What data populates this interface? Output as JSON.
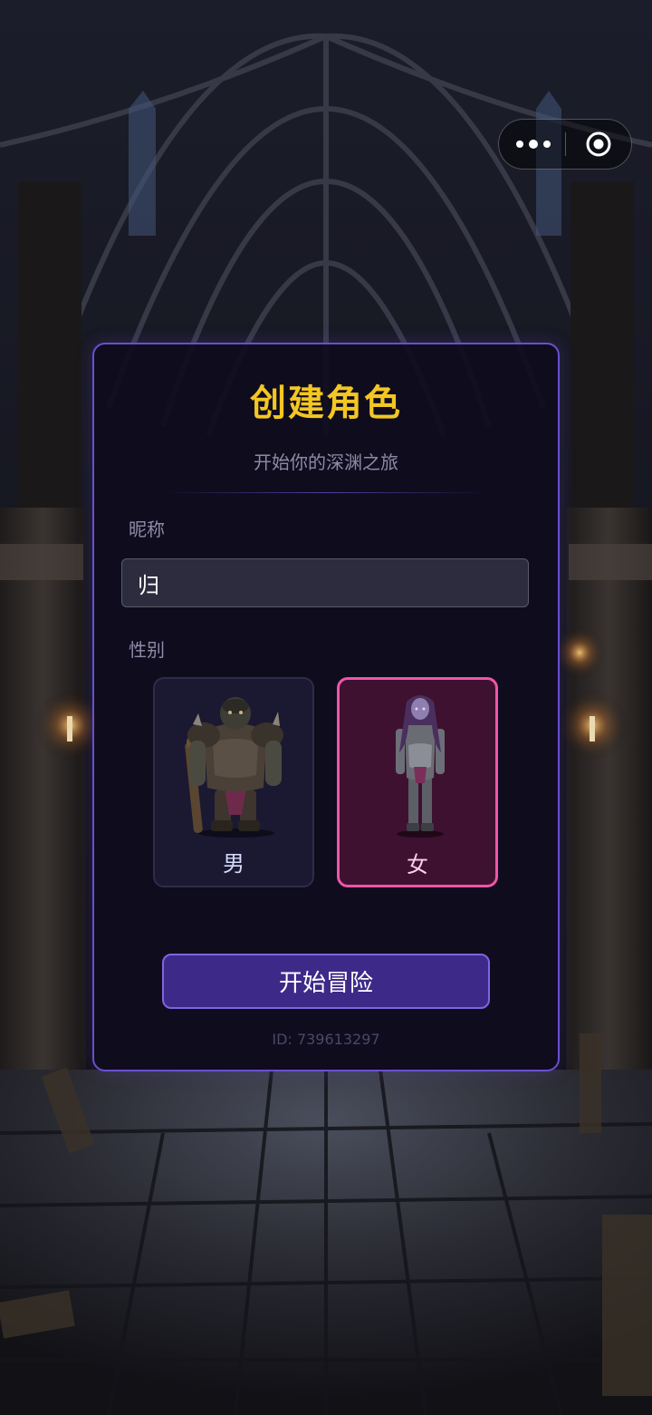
{
  "form": {
    "title": "创建角色",
    "subtitle": "开始你的深渊之旅",
    "nickname_label": "昵称",
    "nickname_value": "归",
    "gender_label": "性别",
    "genders": [
      {
        "label": "男",
        "selected": false
      },
      {
        "label": "女",
        "selected": true
      }
    ],
    "start_button": "开始冒险",
    "user_id": "ID: 739613297"
  },
  "colors": {
    "title": "#f3c623",
    "card_border": "#6a4fd0",
    "selected_border": "#f055a9",
    "button_bg": "#3d2a88"
  },
  "icons": {
    "capsule_more": "more-dots-icon",
    "capsule_close": "target-close-icon"
  }
}
